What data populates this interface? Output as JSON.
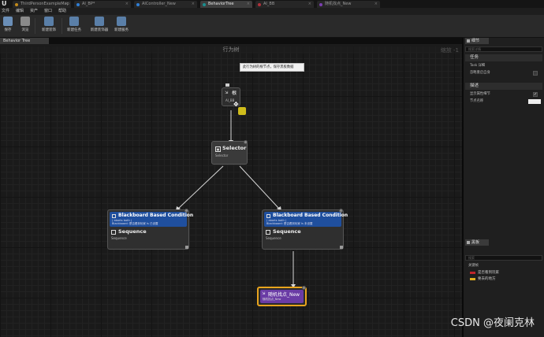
{
  "app": {
    "logo": "U"
  },
  "tabs": [
    {
      "label": "ThirdPersonExampleMap",
      "active": false,
      "color": "#c28a1a"
    },
    {
      "label": "AI_BP*",
      "active": false,
      "color": "#2f7fd6"
    },
    {
      "label": "AIController_New",
      "active": false,
      "color": "#2f7fd6"
    },
    {
      "label": "BehaviorTree",
      "active": true,
      "color": "#1a8f8f"
    },
    {
      "label": "AI_BB",
      "active": false,
      "color": "#b0303a"
    },
    {
      "label": "随机找点_New",
      "active": false,
      "color": "#7c3fb0"
    }
  ],
  "menu": [
    "文件",
    "编辑",
    "资产",
    "窗口",
    "帮助"
  ],
  "toolbar": [
    {
      "label": "保存",
      "icon": "save-icon",
      "color": "#6b8fb8"
    },
    {
      "label": "浏览",
      "icon": "browse-icon",
      "color": "#8a8a8a"
    },
    {
      "label": "新建装饰",
      "icon": "new-decorator-icon",
      "color": "#5a7fa8"
    },
    {
      "label": "新建任务",
      "icon": "new-task-icon",
      "color": "#5a7fa8"
    },
    {
      "label": "新建装饰器",
      "icon": "new-decorator-icon",
      "color": "#5a7fa8"
    },
    {
      "label": "新建服务",
      "icon": "new-service-icon",
      "color": "#5a7fa8"
    }
  ],
  "editor_tab": "Behavior Tree",
  "graph": {
    "title": "行为树",
    "zoom": "缩放 -1",
    "watermark": "CSDN @夜阑克林",
    "tooltip": "此行为树的根节点，保存黑板数据",
    "root": {
      "title": "根",
      "sub": "AI_BB",
      "icon": "root-icon"
    },
    "selector": {
      "title": "Selector",
      "sub": "Selector",
      "icon": "selector-icon"
    },
    "left_branch": {
      "decorator_title": "Blackboard Based Condition",
      "decorator_line1": "( aborts both )",
      "decorator_line2": "Blackboard: 是否看到玩家 Is 已设置",
      "composite_title": "Sequence",
      "composite_sub": "Sequence"
    },
    "right_branch": {
      "decorator_title": "Blackboard Based Condition",
      "decorator_line1": "( aborts both )",
      "decorator_line2": "Blackboard: 是否看到玩家 Is 未设置",
      "composite_title": "Sequence",
      "composite_sub": "Sequence"
    },
    "task": {
      "title": "随机找点_New",
      "sub": "随机找点_New",
      "icon": "task-icon"
    },
    "colors": {
      "decorator": "#1f4f9e",
      "task": "#6a3ba5",
      "node": "#3a3a3a",
      "selected": "#e8a41e"
    }
  },
  "details": {
    "tab": "细节",
    "search_placeholder": "搜索详情",
    "section_task": "任务",
    "task_label": "Task 详细",
    "ignore_label": "忽略重启自身",
    "section_desc": "描述",
    "show_property_label": "显示属性细节",
    "node_name_label": "节点名称"
  },
  "blackboard": {
    "tab": "黑板",
    "search_placeholder": "搜索",
    "section": "关键帧",
    "keys": [
      {
        "name": "是否看到玩家",
        "color": "#c0262b"
      },
      {
        "name": "要去的地方",
        "color": "#e0b020"
      }
    ]
  }
}
